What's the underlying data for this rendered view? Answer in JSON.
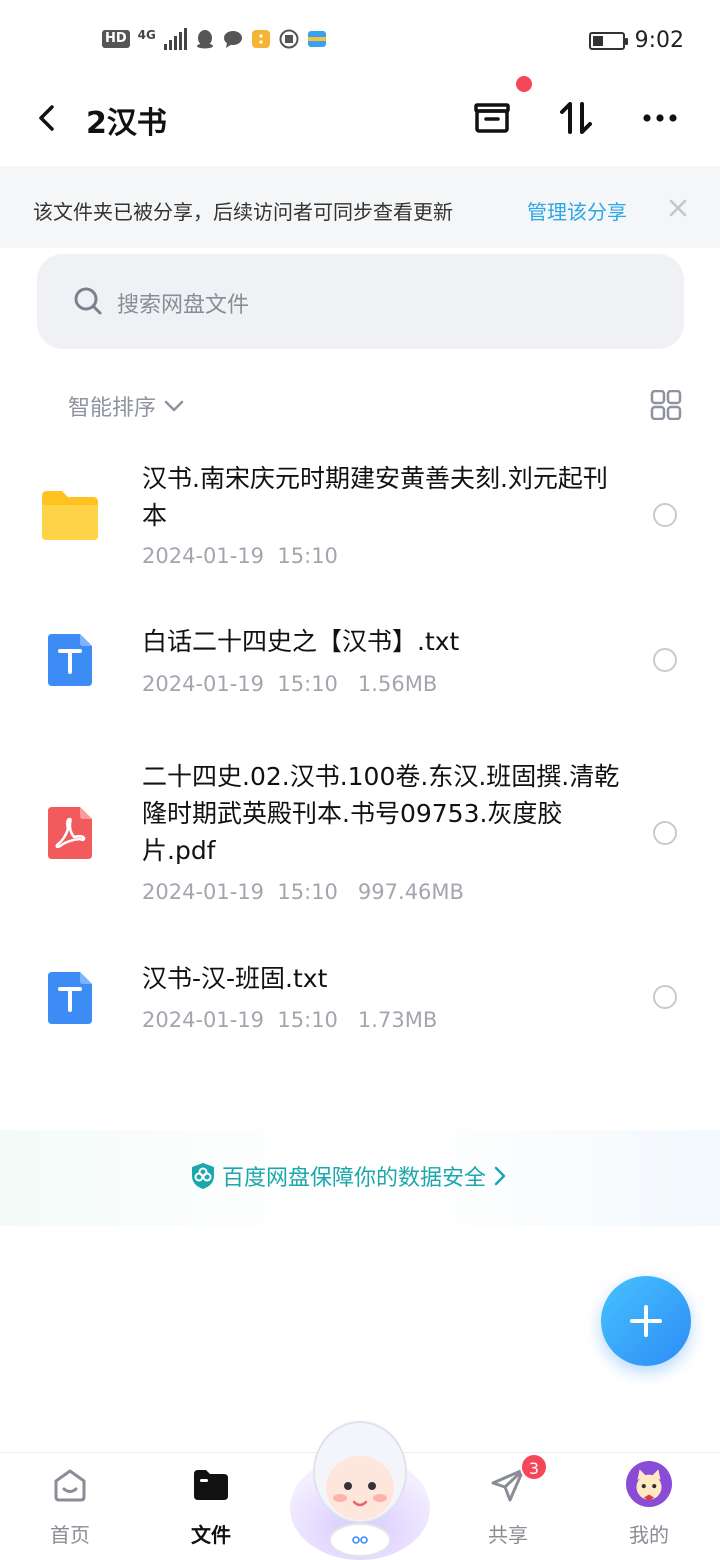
{
  "status_bar": {
    "hd_label": "HD",
    "network_label": "4G",
    "time": "9:02",
    "battery_level": 0.35
  },
  "header": {
    "title": "2汉书",
    "archive_icon": "archive-icon",
    "sort_icon": "sort-icon",
    "more_icon": "more-icon"
  },
  "notice": {
    "text": "该文件夹已被分享，后续访问者可同步查看更新",
    "link": "管理该分享"
  },
  "search": {
    "placeholder": "搜索网盘文件"
  },
  "sort": {
    "label": "智能排序"
  },
  "files": [
    {
      "name": "汉书.南宋庆元时期建安黄善夫刻.刘元起刊本",
      "meta": "2024-01-19  15:10",
      "icon": "folder-icon"
    },
    {
      "name": "白话二十四史之【汉书】.txt",
      "meta": "2024-01-19  15:10   1.56MB",
      "icon": "txt-file-icon"
    },
    {
      "name": "二十四史.02.汉书.100卷.东汉.班固撰.清乾隆时期武英殿刊本.书号09753.灰度胶片.pdf",
      "meta": "2024-01-19  15:10   997.46MB",
      "icon": "pdf-file-icon"
    },
    {
      "name": "汉书-汉-班固.txt",
      "meta": "2024-01-19  15:10   1.73MB",
      "icon": "txt-file-icon"
    }
  ],
  "safety": {
    "text": "百度网盘保障你的数据安全"
  },
  "bottom_nav": {
    "home": "首页",
    "files": "文件",
    "share": "共享",
    "share_badge": "3",
    "me": "我的"
  },
  "colors": {
    "accent": "#2ba8e6",
    "safety": "#1ca7ad",
    "badge": "#f5465a",
    "folder": "#ffcb2f",
    "txt": "#3d8cf5",
    "pdf": "#f25b5b"
  }
}
